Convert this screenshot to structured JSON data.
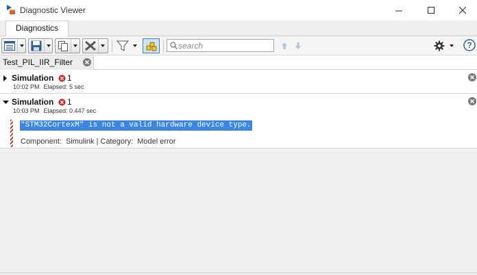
{
  "window": {
    "title": "Diagnostic Viewer"
  },
  "tabs": {
    "main": "Diagnostics"
  },
  "toolbar": {
    "search_placeholder": "search",
    "search_value": ""
  },
  "document_tab": {
    "label": "Test_PIL_IIR_Filter"
  },
  "runs": [
    {
      "title": "Simulation",
      "error_count": "1",
      "time": "10:02 PM",
      "elapsed": "Elapsed: 5 sec",
      "expanded": false
    },
    {
      "title": "Simulation",
      "error_count": "1",
      "time": "10:03 PM",
      "elapsed": "Elapsed: 0.447 sec",
      "expanded": true,
      "message": "\"STM32CortexM\" is not a valid hardware device type.",
      "component_label": "Component:",
      "component_value": "Simulink",
      "separator": "|",
      "category_label": "Category:",
      "category_value": "Model error"
    }
  ],
  "colors": {
    "selection": "#3a86e0",
    "error": "#d62020",
    "toggle_active": "#cfe3f7"
  },
  "icons": {
    "app": "matlab-diagnostic-icon",
    "view": "view-list-icon",
    "save": "save-icon",
    "copy": "copy-icon",
    "clear": "clear-x-icon",
    "filter": "filter-icon",
    "toggle": "group-highlight-icon",
    "search": "search-icon",
    "up": "arrow-up-icon",
    "down": "arrow-down-icon",
    "settings": "gear-icon",
    "help": "help-icon"
  }
}
